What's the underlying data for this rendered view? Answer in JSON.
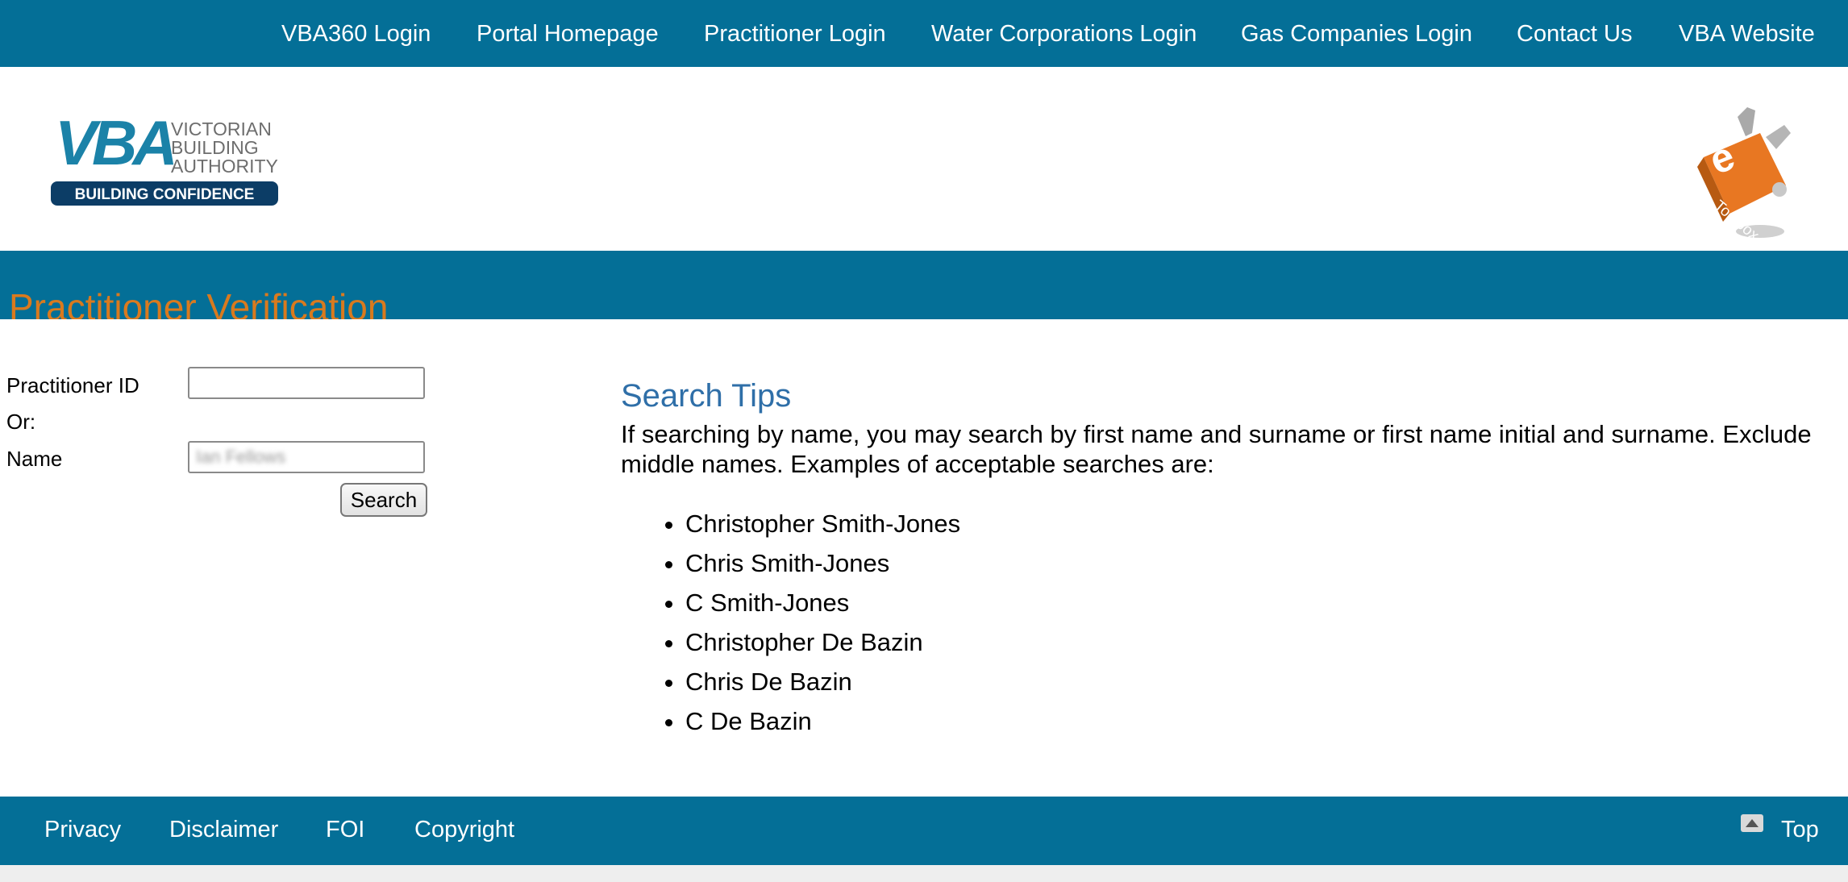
{
  "topnav": {
    "items": [
      {
        "label": "VBA360 Login"
      },
      {
        "label": "Portal Homepage"
      },
      {
        "label": "Practitioner Login"
      },
      {
        "label": "Water Corporations Login"
      },
      {
        "label": "Gas Companies Login"
      },
      {
        "label": "Contact Us"
      },
      {
        "label": "VBA Website"
      }
    ]
  },
  "logo": {
    "letters": "VBA",
    "org_line1": "VICTORIAN",
    "org_line2": "BUILDING",
    "org_line3": "AUTHORITY",
    "tagline": "BUILDING CONFIDENCE"
  },
  "toolbox": {
    "letter": "e",
    "word": "Toolbox"
  },
  "page": {
    "title": "Practitioner Verification"
  },
  "form": {
    "practitioner_id_label": "Practitioner ID",
    "practitioner_id_value": "",
    "or_label": "Or:",
    "name_label": "Name",
    "name_value": "Ian Fellows",
    "search_button": "Search"
  },
  "tips": {
    "title": "Search Tips",
    "text": "If searching by name, you may search by first name and surname or first name initial and surname. Exclude middle names. Examples of acceptable searches are:",
    "examples": [
      "Christopher Smith-Jones",
      "Chris Smith-Jones",
      "C Smith-Jones",
      "Christopher De Bazin",
      "Chris De Bazin",
      "C De Bazin"
    ]
  },
  "footer": {
    "links": [
      {
        "label": "Privacy"
      },
      {
        "label": "Disclaimer"
      },
      {
        "label": "FOI"
      },
      {
        "label": "Copyright"
      }
    ],
    "top_label": "Top"
  },
  "colors": {
    "brand_blue": "#046f97",
    "title_orange": "#d97a1e",
    "tips_blue": "#2f6fa8"
  }
}
